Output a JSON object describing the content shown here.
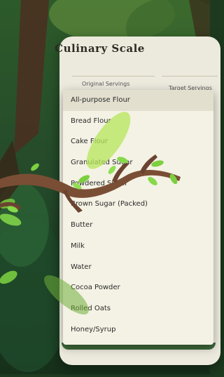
{
  "app": {
    "title": "Culinary Scale"
  },
  "fields": {
    "original_label": "Original Servings",
    "target_label": "Target Servings"
  },
  "dropdown": {
    "selected": "All-purpose Flour",
    "items": [
      "All-purpose Flour",
      "Bread Flour",
      "Cake Flour",
      "Granulated Sugar",
      "Powdered Sugar",
      "Brown Sugar (Packed)",
      "Butter",
      "Milk",
      "Water",
      "Cocoa Powder",
      "Rolled Oats",
      "Honey/Syrup"
    ]
  },
  "icons": {
    "scene": "jungle-background",
    "decor": [
      "tree-branch-icon",
      "falling-leaf-icon"
    ]
  },
  "colors": {
    "card": "#eceadd",
    "menu": "#f4f2e4",
    "selected": "#e2dfcf",
    "accent_green": "#3e6a3b"
  }
}
